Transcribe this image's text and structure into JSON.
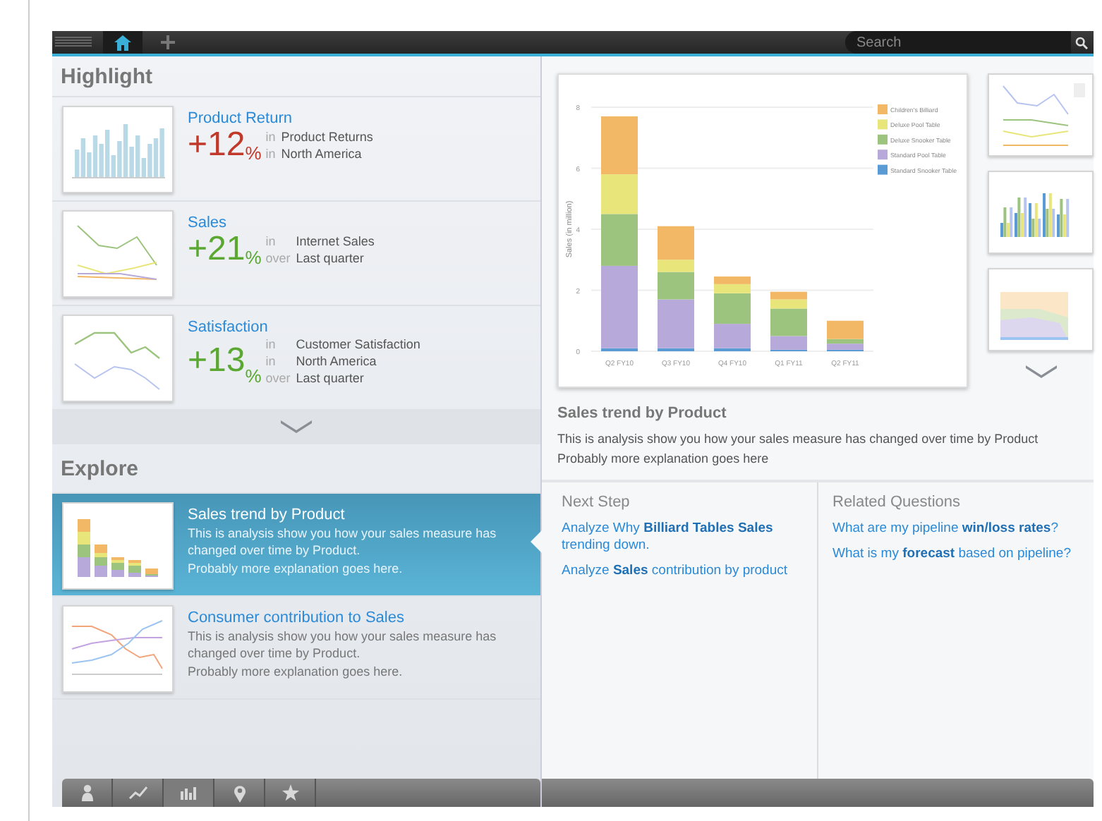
{
  "top_bar": {
    "tabs": [
      {
        "kind": "home",
        "selected": true
      },
      {
        "kind": "add",
        "selected": false
      }
    ],
    "search": {
      "placeholder": "Search"
    }
  },
  "highlight": {
    "title": "Highlight",
    "items": [
      {
        "title": "Product Return",
        "value": "+12",
        "unit": "%",
        "color": "#c0392b",
        "kind": "bars",
        "details": [
          {
            "prefix": "in",
            "text": "Product Returns"
          },
          {
            "prefix": "in",
            "text": "North America"
          }
        ]
      },
      {
        "title": "Sales",
        "value": "+21",
        "unit": "%",
        "color": "#5aa832",
        "kind": "lines",
        "details": [
          {
            "prefix": "in",
            "text": "Internet Sales"
          },
          {
            "prefix": "over",
            "text": "Last quarter"
          }
        ]
      },
      {
        "title": "Satisfaction",
        "value": "+13",
        "unit": "%",
        "color": "#5aa832",
        "kind": "lines2",
        "details": [
          {
            "prefix": "in",
            "text": "Customer Satisfaction"
          },
          {
            "prefix": "in",
            "text": "North America"
          },
          {
            "prefix": "over",
            "text": "Last quarter"
          }
        ]
      }
    ]
  },
  "explore": {
    "title": "Explore",
    "items": [
      {
        "title": "Sales trend by Product",
        "selected": true,
        "kind": "stacked",
        "description": [
          "This is analysis show you how your sales measure has changed over time by Product.",
          "Probably more explanation goes here."
        ]
      },
      {
        "title": "Consumer contribution to Sales",
        "selected": false,
        "kind": "multiline",
        "description": [
          "This is analysis show you how your sales measure has changed over time by Product.",
          "Probably more explanation goes here."
        ]
      }
    ]
  },
  "toolbar": [
    {
      "kind": "person",
      "selected": false
    },
    {
      "kind": "trend",
      "selected": false
    },
    {
      "kind": "bars",
      "selected": true
    },
    {
      "kind": "pin",
      "selected": false
    },
    {
      "kind": "star",
      "selected": false
    }
  ],
  "detail": {
    "chart_data": {
      "type": "bar",
      "stacked": true,
      "grid": true,
      "legend": true,
      "ylabel": "Sales (in million)",
      "categories": [
        "Q2 FY10",
        "Q3 FY10",
        "Q4 FY10",
        "Q1 FY11",
        "Q2 FY11"
      ],
      "ylim": [
        0,
        8
      ],
      "yticks": [
        0,
        2,
        4,
        6,
        8
      ],
      "series": [
        {
          "name": "Standard Snooker Table",
          "color": "#5b9bd5",
          "values": [
            0.1,
            0.1,
            0.1,
            0.05,
            0.05
          ]
        },
        {
          "name": "Standard Pool Table",
          "color": "#b7a9d9",
          "values": [
            2.7,
            1.6,
            0.8,
            0.45,
            0.2
          ]
        },
        {
          "name": "Deluxe Snooker Table",
          "color": "#9cc47e",
          "values": [
            1.7,
            0.9,
            1.0,
            0.9,
            0.15
          ]
        },
        {
          "name": "Deluxe Pool Table",
          "color": "#e8e67a",
          "values": [
            1.3,
            0.4,
            0.3,
            0.3,
            0
          ]
        },
        {
          "name": "Children's Billiard",
          "color": "#f2b866",
          "values": [
            1.9,
            1.1,
            0.25,
            0.25,
            0.6
          ]
        }
      ]
    },
    "thumbnails": [
      {
        "kind": "line"
      },
      {
        "kind": "grouped"
      },
      {
        "kind": "area"
      }
    ],
    "title": "Sales trend by Product",
    "description": [
      "This is analysis show you how your sales measure has changed over time by Product",
      "Probably more explanation goes here"
    ],
    "next_step": {
      "title": "Next Step",
      "links": [
        "Analyze Why **Billiard Tables Sales** trending down.",
        "Analyze **Sales** contribution by product"
      ]
    },
    "related_questions": {
      "title": "Related Questions",
      "links": [
        "What are my pipeline **win/loss rates**?",
        "What is my **forecast** based on pipeline?"
      ]
    }
  }
}
